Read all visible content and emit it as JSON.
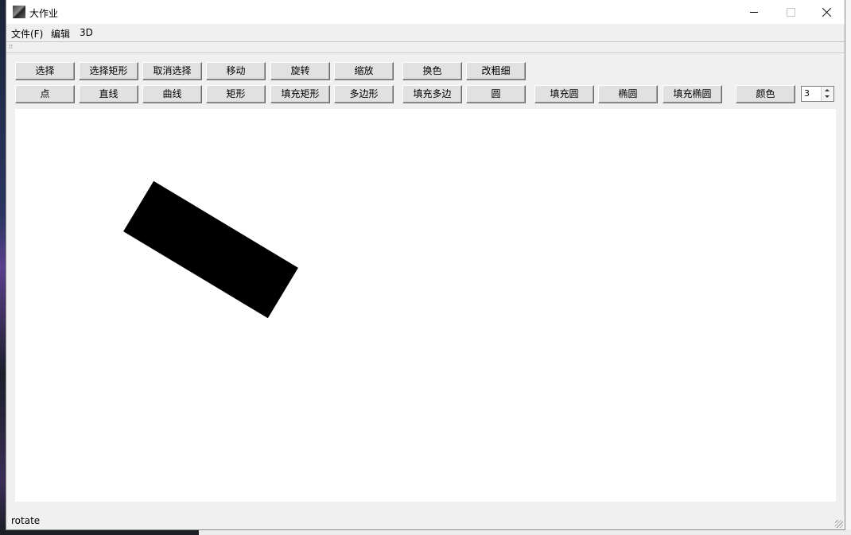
{
  "window": {
    "title": "大作业",
    "min_label": "",
    "max_label": "",
    "close_label": ""
  },
  "menu": [
    "文件(F)",
    "编辑",
    "3D"
  ],
  "toolbar": {
    "row1": [
      "选择",
      "选择矩形",
      "取消选择",
      "移动",
      "旋转",
      "缩放",
      "换色",
      "改粗细"
    ],
    "row2": [
      "点",
      "直线",
      "曲线",
      "矩形",
      "填充矩形",
      "多边形",
      "填充多边",
      "圆",
      "填充圆",
      "椭圆",
      "填充椭圆",
      "颜色"
    ],
    "line_width": "3"
  },
  "canvas": {
    "shape": "rotated-filled-rectangle",
    "fill_color": "#000000"
  },
  "status": {
    "text": "rotate"
  },
  "colors": {
    "titlebar": "#ffffff",
    "chrome": "#f0f0f0",
    "button_face": "#e1e1e1",
    "canvas": "#ffffff"
  }
}
